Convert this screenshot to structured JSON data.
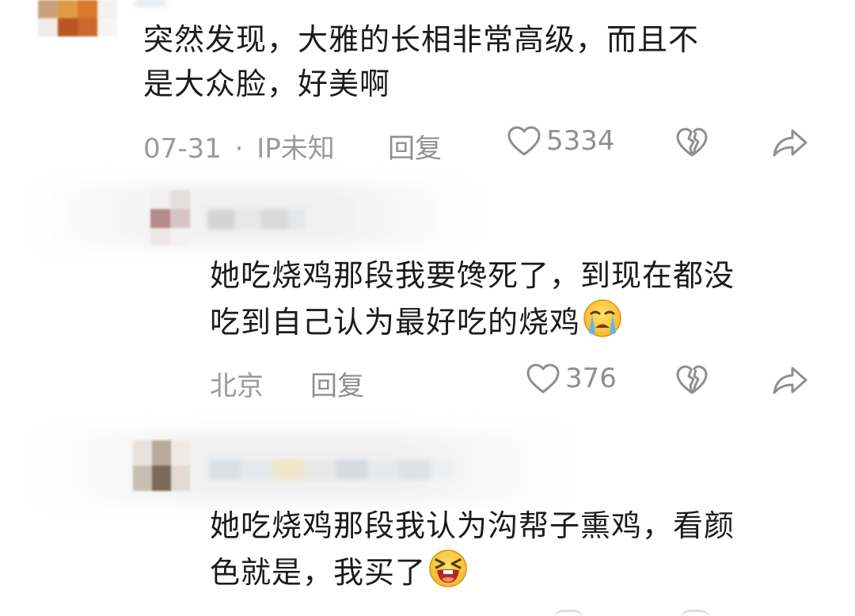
{
  "comments": [
    {
      "text_line1": "突然发现，大雅的长相非常高级，而且不",
      "text_line2": "是大众脸，好美啊",
      "date": "07-31",
      "separator": "·",
      "location": "IP未知",
      "reply_label": "回复",
      "likes": "5334"
    },
    {
      "text_line1": "她吃烧鸡那段我要馋死了，到现在都没",
      "text_line2": "吃到自己认为最好吃的烧鸡",
      "emoji": "crying-face",
      "location": "北京",
      "reply_label": "回复",
      "likes": "376"
    },
    {
      "text_line1": "她吃烧鸡那段我认为沟帮子熏鸡，看颜",
      "text_line2": "色就是，我买了",
      "emoji": "laughing-face"
    }
  ],
  "colors": {
    "text": "#1b1b1b",
    "meta": "#9a9a9a",
    "icon": "#8f8f8f"
  }
}
